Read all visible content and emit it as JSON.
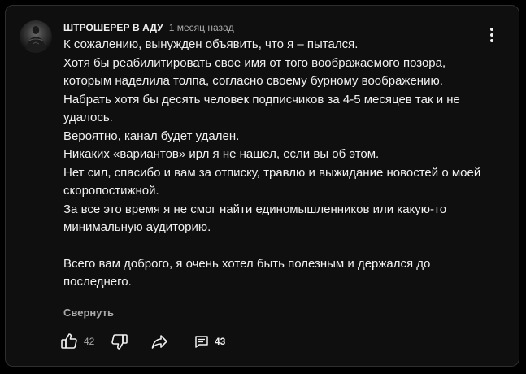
{
  "comment": {
    "author": "ШТРОШЕРЕР В АДУ",
    "time": "1 месяц назад",
    "lines": [
      "К сожалению, вынужден объявить, что я – пытался.",
      "Хотя бы реабилитировать свое имя от того воображаемого позора, которым наделила толпа, согласно своему бурному воображению.",
      "Набрать хотя бы десять человек подписчиков за 4-5 месяцев так и не удалось.",
      "Вероятно, канал будет удален.",
      "Никаких «вариантов» ирл я не нашел, если вы об этом.",
      "Нет сил, спасибо и вам за отписку, травлю и выжидание новостей о моей скоропостижной.",
      "За все это время я не смог найти единомышленников или какую-то минимальную аудиторию.",
      "Всего вам доброго, я очень хотел быть полезным и держался до последнего."
    ],
    "collapse_label": "Свернуть",
    "likes": "42",
    "replies": "43"
  },
  "icons": {
    "menu": "more-vert-icon",
    "like": "thumb-up-icon",
    "dislike": "thumb-down-icon",
    "share": "share-icon",
    "replies": "comment-icon"
  }
}
